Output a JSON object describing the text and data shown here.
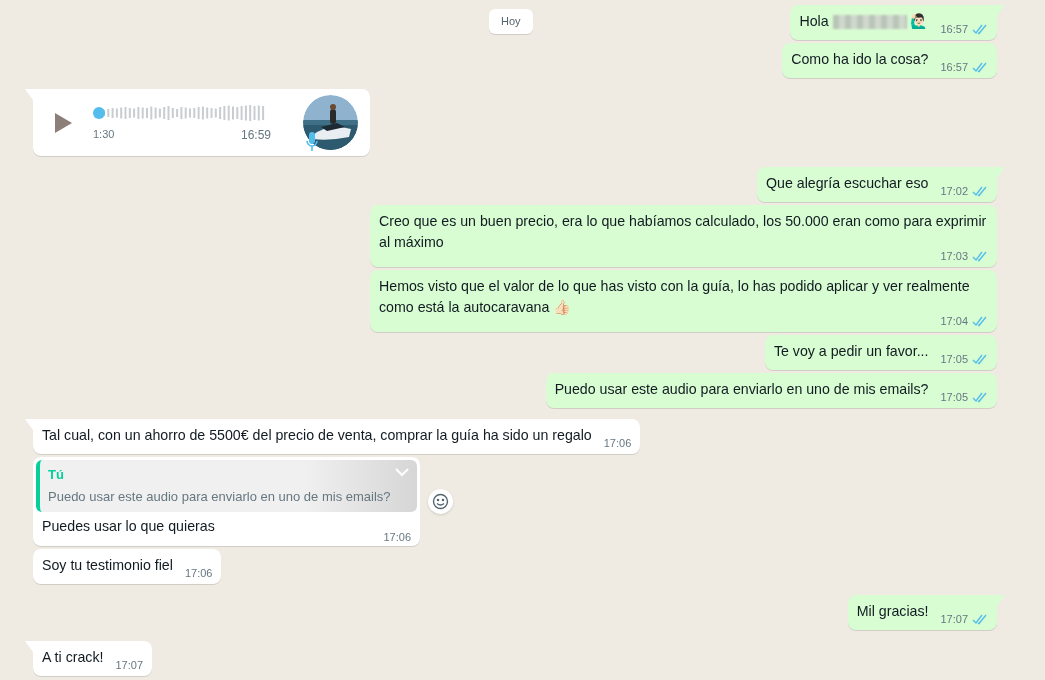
{
  "date_chip": "Hoy",
  "messages": [
    {
      "kind": "text",
      "outgoing": true,
      "tail": true,
      "parts": [
        {
          "kind": "text",
          "value": "Hola "
        },
        {
          "kind": "redacted"
        },
        {
          "kind": "text",
          "value": " 🙋🏻‍♂️"
        }
      ],
      "time": "16:57",
      "read": true
    },
    {
      "kind": "text",
      "outgoing": true,
      "tail": false,
      "parts": [
        {
          "kind": "text",
          "value": "Como ha ido la cosa?"
        }
      ],
      "time": "16:57",
      "read": true
    },
    {
      "kind": "audio",
      "outgoing": false,
      "tail": true,
      "duration": "1:30",
      "time": "16:59"
    },
    {
      "kind": "text",
      "outgoing": true,
      "tail": true,
      "parts": [
        {
          "kind": "text",
          "value": "Que alegría escuchar eso"
        }
      ],
      "time": "17:02",
      "read": true
    },
    {
      "kind": "text",
      "outgoing": true,
      "tail": false,
      "parts": [
        {
          "kind": "text",
          "value": "Creo que es un buen precio, era lo que habíamos calculado, los 50.000 eran como para exprimir al máximo"
        }
      ],
      "time": "17:03",
      "read": true
    },
    {
      "kind": "text",
      "outgoing": true,
      "tail": false,
      "parts": [
        {
          "kind": "text",
          "value": "Hemos visto que el valor de lo que has visto con la guía, lo has podido aplicar y ver realmente como está la autocaravana 👍🏻"
        }
      ],
      "time": "17:04",
      "read": true
    },
    {
      "kind": "text",
      "outgoing": true,
      "tail": false,
      "parts": [
        {
          "kind": "text",
          "value": "Te voy a pedir un favor..."
        }
      ],
      "time": "17:05",
      "read": true
    },
    {
      "kind": "text",
      "outgoing": true,
      "tail": false,
      "parts": [
        {
          "kind": "text",
          "value": "Puedo usar este audio para enviarlo en uno de mis emails?"
        }
      ],
      "time": "17:05",
      "read": true
    },
    {
      "kind": "text",
      "outgoing": false,
      "tail": true,
      "parts": [
        {
          "kind": "text",
          "value": "Tal cual, con un ahorro de 5500€ del precio de venta, comprar la guía ha sido un regalo"
        }
      ],
      "time": "17:06"
    },
    {
      "kind": "reply",
      "outgoing": false,
      "tail": false,
      "quote_author": "Tú",
      "quote_text": "Puedo usar este audio para enviarlo en uno de mis emails?",
      "text": "Puedes usar lo que quieras",
      "time": "17:06",
      "reaction_button": true
    },
    {
      "kind": "text",
      "outgoing": false,
      "tail": false,
      "parts": [
        {
          "kind": "text",
          "value": "Soy tu testimonio fiel"
        }
      ],
      "time": "17:06"
    },
    {
      "kind": "text",
      "outgoing": true,
      "tail": true,
      "parts": [
        {
          "kind": "text",
          "value": "Mil gracias!"
        }
      ],
      "time": "17:07",
      "read": true
    },
    {
      "kind": "text",
      "outgoing": false,
      "tail": true,
      "parts": [
        {
          "kind": "text",
          "value": "A ti crack!"
        }
      ],
      "time": "17:07"
    }
  ]
}
